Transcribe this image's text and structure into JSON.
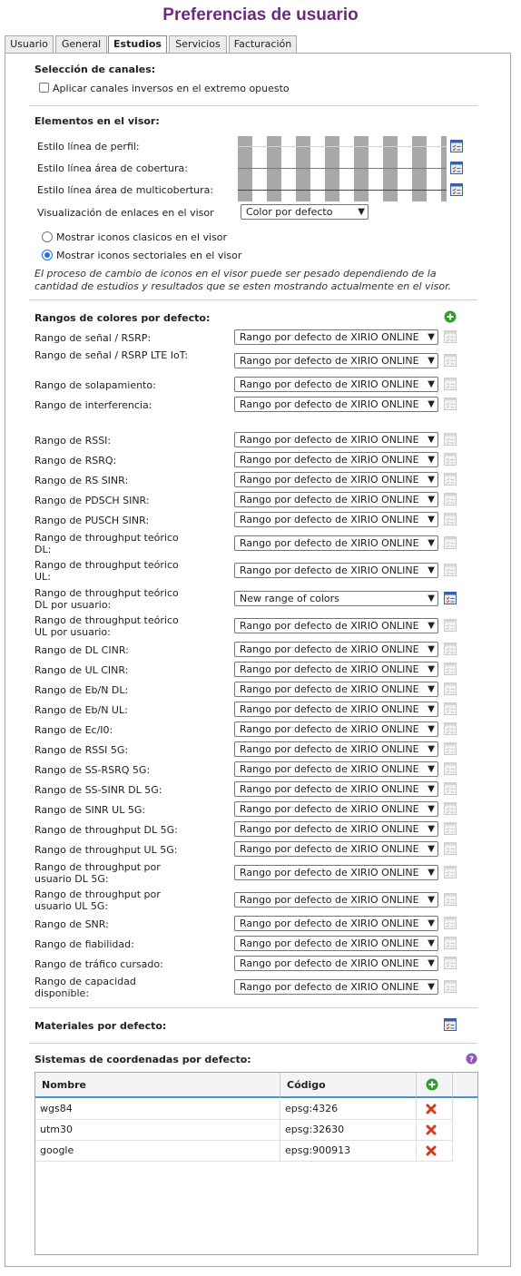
{
  "page": {
    "title": "Preferencias de usuario"
  },
  "tabs": [
    {
      "label": "Usuario",
      "active": false
    },
    {
      "label": "General",
      "active": false
    },
    {
      "label": "Estudios",
      "active": true
    },
    {
      "label": "Servicios",
      "active": false
    },
    {
      "label": "Facturación",
      "active": false
    }
  ],
  "channels": {
    "title": "Selección de canales:",
    "inverse_label": "Aplicar canales inversos en el extremo opuesto",
    "inverse_checked": false
  },
  "viewer": {
    "title": "Elementos en el visor:",
    "profile_label": "Estilo línea de perfil:",
    "profile_color": "#f2e14c",
    "coverage_label": "Estilo línea área de cobertura:",
    "coverage_color": "#d9534f",
    "multicoverage_label": "Estilo línea área de multicobertura:",
    "multicoverage_color": "#2b3fbf",
    "links_label": "Visualización de enlaces en el visor",
    "links_value": "Color por defecto",
    "radio_classic": "Mostrar iconos clasicos en el visor",
    "radio_sector": "Mostrar iconos sectoriales en el visor",
    "selected_radio": "sector",
    "note": "El proceso de cambio de iconos en el visor puede ser pesado dependiendo de la cantidad de estudios y resultados que se esten mostrando actualmente en el visor."
  },
  "ranges": {
    "title": "Rangos de colores por defecto:",
    "default_value": "Rango por defecto de XIRIO ONLINE",
    "items": [
      {
        "label": "Rango de señal / RSRP:",
        "value": "Rango por defecto de XIRIO ONLINE",
        "editable": false
      },
      {
        "label": "Rango de señal / RSRP LTE IoT:",
        "value": "Rango por defecto de XIRIO ONLINE",
        "editable": false
      },
      {
        "label": "Rango de solapamiento:",
        "value": "Rango por defecto de XIRIO ONLINE",
        "editable": false
      },
      {
        "label": "Rango de interferencia:",
        "value": "Rango por defecto de XIRIO ONLINE",
        "editable": false
      },
      {
        "label": "Rango de RSSI:",
        "value": "Rango por defecto de XIRIO ONLINE",
        "editable": false
      },
      {
        "label": "Rango de RSRQ:",
        "value": "Rango por defecto de XIRIO ONLINE",
        "editable": false
      },
      {
        "label": "Rango de RS SINR:",
        "value": "Rango por defecto de XIRIO ONLINE",
        "editable": false
      },
      {
        "label": "Rango de PDSCH SINR:",
        "value": "Rango por defecto de XIRIO ONLINE",
        "editable": false
      },
      {
        "label": "Rango de PUSCH SINR:",
        "value": "Rango por defecto de XIRIO ONLINE",
        "editable": false
      },
      {
        "label": "Rango de throughput teórico DL:",
        "value": "Rango por defecto de XIRIO ONLINE",
        "editable": false
      },
      {
        "label": "Rango de throughput teórico UL:",
        "value": "Rango por defecto de XIRIO ONLINE",
        "editable": false
      },
      {
        "label": "Rango de throughput teórico DL por usuario:",
        "value": "New range of colors",
        "editable": true
      },
      {
        "label": "Rango de throughput teórico UL por usuario:",
        "value": "Rango por defecto de XIRIO ONLINE",
        "editable": false
      },
      {
        "label": "Rango de DL CINR:",
        "value": "Rango por defecto de XIRIO ONLINE",
        "editable": false
      },
      {
        "label": "Rango de UL CINR:",
        "value": "Rango por defecto de XIRIO ONLINE",
        "editable": false
      },
      {
        "label": "Rango de Eb/N DL:",
        "value": "Rango por defecto de XIRIO ONLINE",
        "editable": false
      },
      {
        "label": "Rango de Eb/N UL:",
        "value": "Rango por defecto de XIRIO ONLINE",
        "editable": false
      },
      {
        "label": "Rango de Ec/I0:",
        "value": "Rango por defecto de XIRIO ONLINE",
        "editable": false
      },
      {
        "label": "Rango de RSSI 5G:",
        "value": "Rango por defecto de XIRIO ONLINE",
        "editable": false
      },
      {
        "label": "Rango de SS-RSRQ 5G:",
        "value": "Rango por defecto de XIRIO ONLINE",
        "editable": false
      },
      {
        "label": "Rango de SS-SINR DL 5G:",
        "value": "Rango por defecto de XIRIO ONLINE",
        "editable": false
      },
      {
        "label": "Rango de SINR UL 5G:",
        "value": "Rango por defecto de XIRIO ONLINE",
        "editable": false
      },
      {
        "label": "Rango de throughput DL 5G:",
        "value": "Rango por defecto de XIRIO ONLINE",
        "editable": false
      },
      {
        "label": "Rango de throughput UL 5G:",
        "value": "Rango por defecto de XIRIO ONLINE",
        "editable": false
      },
      {
        "label": "Rango de throughput por usuario DL 5G:",
        "value": "Rango por defecto de XIRIO ONLINE",
        "editable": false
      },
      {
        "label": "Rango de throughput por usuario UL 5G:",
        "value": "Rango por defecto de XIRIO ONLINE",
        "editable": false
      },
      {
        "label": "Rango de SNR:",
        "value": "Rango por defecto de XIRIO ONLINE",
        "editable": false
      },
      {
        "label": "Rango de fiabilidad:",
        "value": "Rango por defecto de XIRIO ONLINE",
        "editable": false
      },
      {
        "label": "Rango de tráfico cursado:",
        "value": "Rango por defecto de XIRIO ONLINE",
        "editable": false
      },
      {
        "label": "Rango de capacidad disponible:",
        "value": "Rango por defecto de XIRIO ONLINE",
        "editable": false
      }
    ]
  },
  "materials": {
    "title": "Materiales por defecto:"
  },
  "coords": {
    "title": "Sistemas de coordenadas por defecto:",
    "headers": {
      "name": "Nombre",
      "code": "Código"
    },
    "rows": [
      {
        "name": "wgs84",
        "code": "epsg:4326"
      },
      {
        "name": "utm30",
        "code": "epsg:32630"
      },
      {
        "name": "google",
        "code": "epsg:900913"
      }
    ]
  },
  "colors": {
    "title": "#6b2a7e",
    "accent_blue": "#4a90d9",
    "add_green": "#2e9e2e",
    "delete_red": "#d9361a"
  }
}
